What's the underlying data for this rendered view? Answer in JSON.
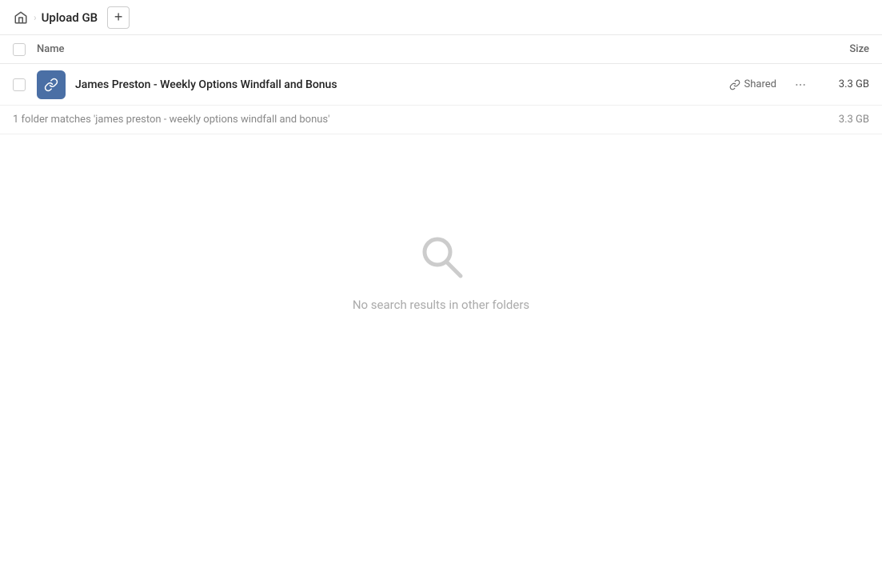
{
  "topbar": {
    "title": "Upload GB",
    "add_button_label": "+"
  },
  "columns": {
    "name_label": "Name",
    "size_label": "Size"
  },
  "file_row": {
    "name": "James Preston - Weekly Options Windfall and Bonus",
    "shared_label": "Shared",
    "size": "3.3 GB"
  },
  "summary": {
    "text": "1 folder matches 'james preston - weekly options windfall and bonus'",
    "size": "3.3 GB"
  },
  "empty_state": {
    "message": "No search results in other folders"
  },
  "icons": {
    "home": "home-icon",
    "link": "link-icon",
    "more": "more-icon",
    "search": "search-icon"
  }
}
